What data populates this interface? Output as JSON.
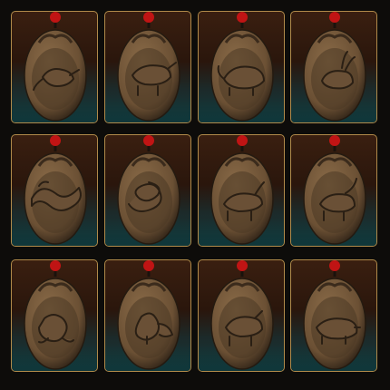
{
  "image": {
    "description_free": true,
    "tiles": [
      {
        "animal": "rat"
      },
      {
        "animal": "ox"
      },
      {
        "animal": "tiger"
      },
      {
        "animal": "rabbit"
      },
      {
        "animal": "dragon"
      },
      {
        "animal": "snake"
      },
      {
        "animal": "horse"
      },
      {
        "animal": "goat"
      },
      {
        "animal": "monkey"
      },
      {
        "animal": "rooster"
      },
      {
        "animal": "dog"
      },
      {
        "animal": "pig"
      }
    ],
    "colors": {
      "frame": "#b08a4a",
      "wood": "#6b5034",
      "bead": "#c01414",
      "backdrop_top": "#3a1f10",
      "backdrop_bottom": "#15393b"
    }
  }
}
